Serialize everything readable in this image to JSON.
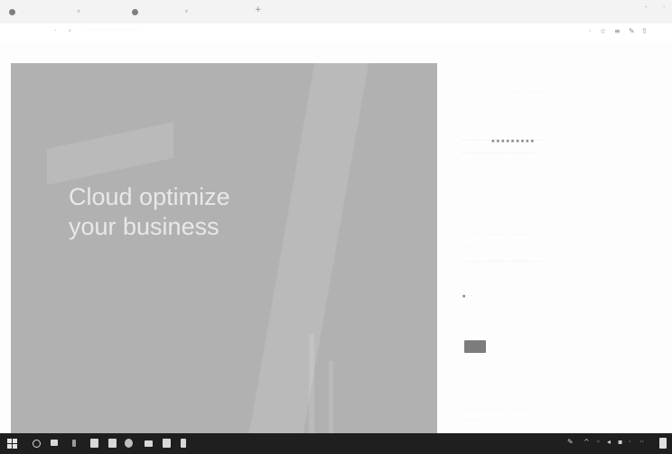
{
  "hero": {
    "title_line1": "Cloud optimize",
    "title_line2": "your business"
  },
  "browser": {
    "new_tab": "+"
  },
  "icons": [
    "favicon-icon",
    "close-icon",
    "back-icon",
    "forward-icon",
    "refresh-icon",
    "star-icon",
    "settings-icon",
    "windows-start-icon",
    "search-icon",
    "task-view-icon",
    "file-explorer-icon",
    "store-icon",
    "edge-icon",
    "mail-icon",
    "network-icon",
    "volume-icon",
    "notification-icon"
  ]
}
